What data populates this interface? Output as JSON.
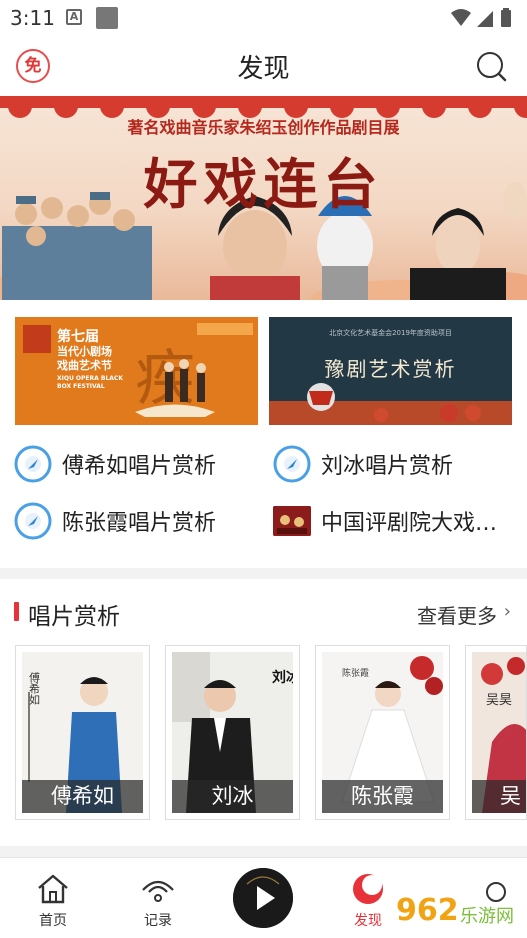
{
  "status_bar": {
    "time": "3:11",
    "a_icon": "A"
  },
  "header": {
    "logo_text": "免",
    "title": "发现",
    "search_icon": "search-icon"
  },
  "banner": {
    "subtitle": "著名戏曲音乐家朱绍玉创作作品剧目展",
    "title": "好戏连台"
  },
  "cards": [
    {
      "lines": [
        "第七届",
        "当代小剧场",
        "戏曲艺术节"
      ],
      "en": "XIQU OPERA BLACK BOX FESTIVAL"
    },
    {
      "header": "北京文化艺术基金会2019年度资助项目",
      "title": "豫剧艺术赏析"
    }
  ],
  "links": [
    {
      "label": "傅希如唱片赏析",
      "icon": "disc-icon"
    },
    {
      "label": "刘冰唱片赏析",
      "icon": "disc-icon"
    },
    {
      "label": "陈张霞唱片赏析",
      "icon": "disc-icon"
    },
    {
      "label": "中国评剧院大戏…",
      "icon": "thumbnail"
    }
  ],
  "section": {
    "title": "唱片赏析",
    "more": "查看更多",
    "more_arrow": "›"
  },
  "albums": [
    {
      "name": "傅希如",
      "poster_text": "傅希如"
    },
    {
      "name": "刘冰",
      "poster_text": "刘冰"
    },
    {
      "name": "陈张霞",
      "poster_text": "陈张霞"
    },
    {
      "name": "吴昊",
      "poster_text": "吴昊"
    }
  ],
  "tabs": [
    {
      "label": "首页",
      "icon": "home-icon",
      "active": false
    },
    {
      "label": "记录",
      "icon": "history-icon",
      "active": false
    },
    {
      "label": "发现",
      "icon": "discover-icon",
      "active": true
    }
  ],
  "watermark": {
    "text": "962",
    "sub": "乐游网"
  },
  "colors": {
    "accent": "#e8323a",
    "card_orange": "#e07a1c",
    "card_dark": "#233845"
  }
}
